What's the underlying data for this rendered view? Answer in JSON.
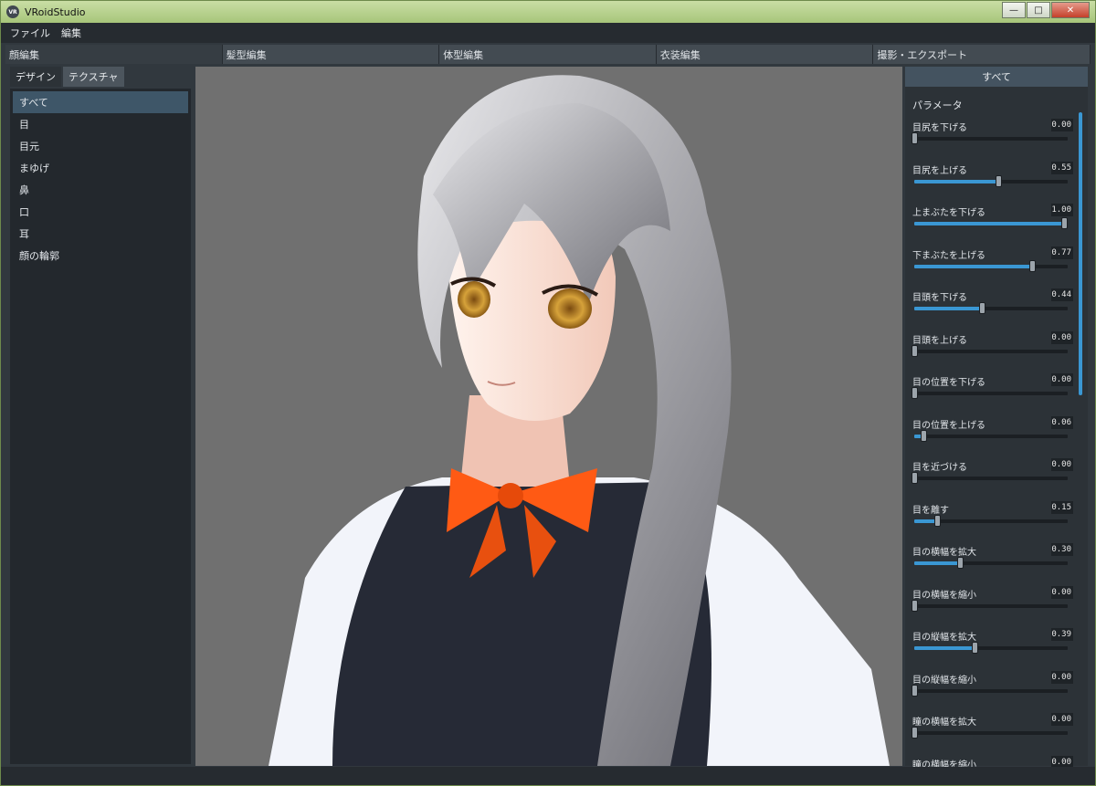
{
  "window": {
    "title": "VRoidStudio",
    "icon_label": "VR"
  },
  "window_controls": {
    "minimize": "—",
    "maximize": "□",
    "close": "✕"
  },
  "menu": [
    "ファイル",
    "編集"
  ],
  "main_tabs": [
    "顔編集",
    "髪型編集",
    "体型編集",
    "衣装編集",
    "撮影・エクスポート"
  ],
  "left": {
    "subtabs": [
      "デザイン",
      "テクスチャ"
    ],
    "categories": [
      "すべて",
      "目",
      "目元",
      "まゆげ",
      "鼻",
      "口",
      "耳",
      "顔の輪郭"
    ]
  },
  "right": {
    "header": "すべて",
    "params_title": "パラメータ",
    "params": [
      {
        "name": "目尻を下げる",
        "value": "0.00"
      },
      {
        "name": "目尻を上げる",
        "value": "0.55"
      },
      {
        "name": "上まぶたを下げる",
        "value": "1.00"
      },
      {
        "name": "下まぶたを上げる",
        "value": "0.77"
      },
      {
        "name": "目頭を下げる",
        "value": "0.44"
      },
      {
        "name": "目頭を上げる",
        "value": "0.00"
      },
      {
        "name": "目の位置を下げる",
        "value": "0.00"
      },
      {
        "name": "目の位置を上げる",
        "value": "0.06"
      },
      {
        "name": "目を近づける",
        "value": "0.00"
      },
      {
        "name": "目を離す",
        "value": "0.15"
      },
      {
        "name": "目の横幅を拡大",
        "value": "0.30"
      },
      {
        "name": "目の横幅を縮小",
        "value": "0.00"
      },
      {
        "name": "目の縦幅を拡大",
        "value": "0.39"
      },
      {
        "name": "目の縦幅を縮小",
        "value": "0.00"
      },
      {
        "name": "瞳の横幅を拡大",
        "value": "0.00"
      },
      {
        "name": "瞳の横幅を縮小",
        "value": "0.00"
      }
    ]
  },
  "colors": {
    "accent": "#3a97d3",
    "selected": "#3e5668",
    "bow": "#ff5a14",
    "hair": "#b9b9bd",
    "eyes": "#c9941f",
    "vest": "#262a36",
    "viewport_bg": "#707070"
  }
}
